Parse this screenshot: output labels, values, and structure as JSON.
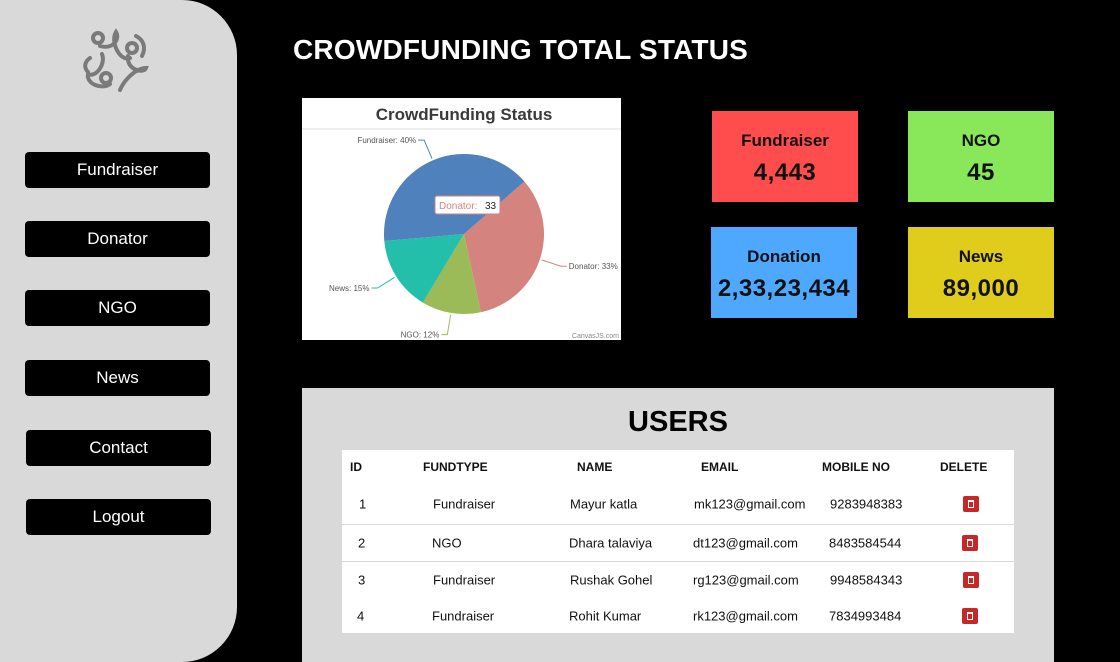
{
  "sidebar": {
    "logo_icon": "people-logo-icon",
    "items": [
      {
        "label": "Fundraiser"
      },
      {
        "label": "Donator"
      },
      {
        "label": "NGO"
      },
      {
        "label": "News"
      },
      {
        "label": "Contact"
      },
      {
        "label": "Logout"
      }
    ]
  },
  "page_title": "CROWDFUNDING TOTAL STATUS",
  "chart_data": {
    "type": "pie",
    "title": "CrowdFunding Status",
    "slices": [
      {
        "label": "Fundraiser",
        "value": 40,
        "color": "#4f81bd"
      },
      {
        "label": "Donator",
        "value": 33,
        "color": "#d5837e"
      },
      {
        "label": "NGO",
        "value": 12,
        "color": "#9bbb59"
      },
      {
        "label": "News",
        "value": 15,
        "color": "#23bfaa"
      }
    ],
    "slice_labels": [
      "Fundraiser: 40%",
      "Donator: 33%",
      "NGO: 12%",
      "News: 15%"
    ],
    "tooltip": {
      "label": "Donator:",
      "value": "33"
    },
    "credit": "CanvasJS.com"
  },
  "cards": [
    {
      "label": "Fundraiser",
      "value": "4,443",
      "color": "#ff4c4c"
    },
    {
      "label": "NGO",
      "value": "45",
      "color": "#88e85a"
    },
    {
      "label": "Donation",
      "value": "2,33,23,434",
      "color": "#4ea8ff"
    },
    {
      "label": "News",
      "value": "89,000",
      "color": "#e0cc1a"
    }
  ],
  "users": {
    "title": "USERS",
    "columns": [
      "ID",
      "FUNDTYPE",
      "NAME",
      "EMAIL",
      "MOBILE NO",
      "DELETE"
    ],
    "rows": [
      {
        "id": "1",
        "fundtype": "Fundraiser",
        "name": "Mayur katla",
        "email": "mk123@gmail.com",
        "mobile": "9283948383"
      },
      {
        "id": "2",
        "fundtype": "NGO",
        "name": "Dhara talaviya",
        "email": "dt123@gmail.com",
        "mobile": "8483584544"
      },
      {
        "id": "3",
        "fundtype": "Fundraiser",
        "name": "Rushak Gohel",
        "email": "rg123@gmail.com",
        "mobile": "9948584343"
      },
      {
        "id": "4",
        "fundtype": "Fundraiser",
        "name": "Rohit Kumar",
        "email": "rk123@gmail.com",
        "mobile": "7834993484"
      }
    ],
    "delete_icon": "trash-icon"
  }
}
